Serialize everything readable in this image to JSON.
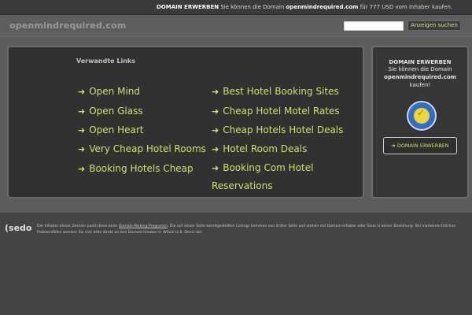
{
  "topbar": {
    "cta": "DOMAIN ERWERBEN",
    "text_before": "Sie können die Domain",
    "domain": "openmindrequired.com",
    "text_after": "für 777 USD vom Inhaber kaufen."
  },
  "header": {
    "site_name": "openmindrequired.com",
    "search_placeholder": "",
    "search_button": "Anzeigen suchen"
  },
  "links_panel": {
    "title": "Verwandte Links",
    "left": [
      "Open Mind",
      "Open Glass",
      "Open Heart",
      "Very Cheap Hotel Rooms",
      "Booking Hotels Cheap"
    ],
    "right": [
      "Best Hotel Booking Sites",
      "Cheap Hotel Motel Rates",
      "Cheap Hotels Hotel Deals",
      "Hotel Room Deals",
      "Booking Com Hotel Reservations"
    ]
  },
  "side_panel": {
    "title": "DOMAIN ERWERBEN",
    "line1": "Sie können die Domain",
    "domain": "openmindrequired.com",
    "line2": "kaufen!",
    "button": "DOMAIN ERWERBEN"
  },
  "footer": {
    "logo": "sedo",
    "text_1": "Der Inhaber dieser Domain parkt diese beim",
    "link": "Domain-Parking-Programm",
    "text_2": ". Die auf dieser Seite bereitgestellten Listings kommen von dritter Seite und stehen mit Domain-Inhaber oder Sedo in keiner Beziehung. Bei markenrechtlichen Problemfällen wenden Sie sich bitte direkt an den Domain-Inhaber lt. Whois (z.B. Denic.de)."
  },
  "colors": {
    "link": "#c6e36b",
    "background": "#4a4a4a"
  }
}
